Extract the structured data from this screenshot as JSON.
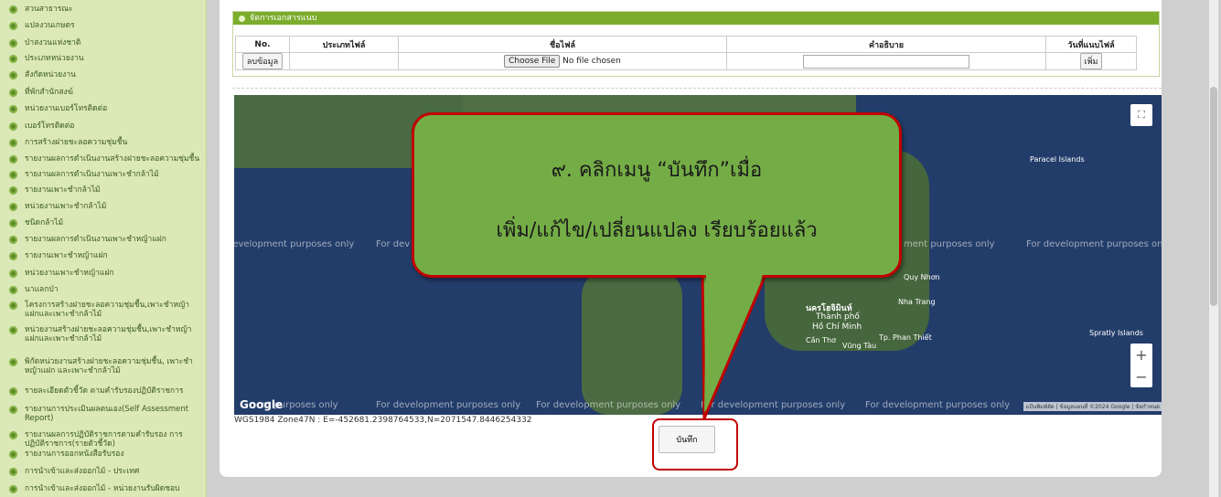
{
  "sidebar": {
    "items": [
      {
        "label": "สวนสาธารณะ"
      },
      {
        "label": "แปลงวนเกษตร"
      },
      {
        "label": "ป่าสงวนแห่งชาติ"
      },
      {
        "label": "ประเภทหน่วยงาน"
      },
      {
        "label": "สังกัดหน่วยงาน"
      },
      {
        "label": "ที่พักสำนักสงฆ์"
      },
      {
        "label": "หน่วยงานเบอร์โทรติดต่อ"
      },
      {
        "label": "เบอร์โทรติดต่อ"
      },
      {
        "label": "การสร้างฝายชะลอความชุ่มชื้น"
      },
      {
        "label": "รายงานผลการดำเนินงานสร้างฝายชะลอความชุ่มชื้น"
      },
      {
        "label": "รายงานผลการดำเนินงานเพาะชำกล้าไม้"
      },
      {
        "label": "รายงานเพาะชำกล้าไม้"
      },
      {
        "label": "หน่วยงานเพาะชำกล้าไม้"
      },
      {
        "label": "ชนิดกล้าไม้"
      },
      {
        "label": "รายงานผลการดำเนินงานเพาะชำหญ้าแฝก"
      },
      {
        "label": "รายงานเพาะชำหญ้าแฝก"
      },
      {
        "label": "หน่วยงานเพาะชำหญ้าแฝก"
      },
      {
        "label": "นาแลกป่า"
      },
      {
        "label": "โครงการสร้างฝายชะลอความชุ่มชื้น,เพาะชำหญ้าแฝกและเพาะชำกล้าไม้"
      },
      {
        "label": "หน่วยงานสร้างฝายชะลอความชุ่มชื้น,เพาะชำหญ้าแฝกและเพาะชำกล้าไม้"
      },
      {
        "label": "พิกัดหน่วยงานสร้างฝายชะลอความชุ่มชื้น, เพาะชำหญ้าแฝก และเพาะชำกล้าไม้"
      },
      {
        "label": "รายละเอียดตัวชี้วัด ตามคำรับรองปฏิบัติราชการ"
      },
      {
        "label": "รายงานการประเมินผลตนเอง(Self Assessment Report)"
      },
      {
        "label": "รายงานผลการปฏิบัติราชการตามคำรับรอง การปฏิบัติราชการ(รายตัวชี้วัด)"
      },
      {
        "label": "รายงานการออกหนังสือรับรอง"
      },
      {
        "label": "การนำเข้าและส่งออกไม้ - ประเทศ"
      },
      {
        "label": "การนำเข้าและส่งออกไม้ - หน่วยงานรับผิดชอบ"
      }
    ]
  },
  "attachments": {
    "header": "จัดการเอกสารแนบ",
    "columns": [
      "No.",
      "ประเภทไฟล์",
      "ชื่อไฟล์",
      "คำอธิบาย",
      "วันที่แนบไฟล์"
    ],
    "row": {
      "delete_label": "ลบข้อมูล",
      "choose_file_label": "Choose File",
      "no_file_label": "No file chosen",
      "add_label": "เพิ่ม"
    }
  },
  "map": {
    "watermark": "For development purposes only",
    "watermark_left": "development purposes only",
    "watermark_cut": "For dev",
    "watermark_right": "ment purposes only",
    "watermark_bottom_left": "nt purposes only",
    "google_logo": "Google",
    "attribution": "แป้นพิมพ์ลัด | ข้อมูลแผนที่ ©2024 Google | ข้อกำหนด",
    "fullscreen_icon": "⛶",
    "zoom_in": "+",
    "zoom_out": "−",
    "labels": {
      "hcm": "นครโฮจิมินห์",
      "thanh_pho": "Thành phố",
      "ho_chi_minh": "Hồ Chí Minh",
      "quy_nhon": "Quy Nhơn",
      "nha_trang": "Nha Trang",
      "phan_thiet": "Tp. Phan Thiết",
      "vung_tau": "Vũng Tàu",
      "can_tho": "Cần Thơ",
      "paracel": "Paracel Islands",
      "spratly": "Spratly Islands"
    }
  },
  "coordinates": "WGS1984 Zone47N : E=-452681.2398764533,N=2071547.8446254332",
  "save_label": "บันทึก",
  "callout": {
    "line1": "๙. คลิกเมนู “บันทึก”เมื่อ",
    "line2": "เพิ่ม/แก้ไข/เปลี่ยนแปลง เรียบร้อยแล้ว"
  }
}
